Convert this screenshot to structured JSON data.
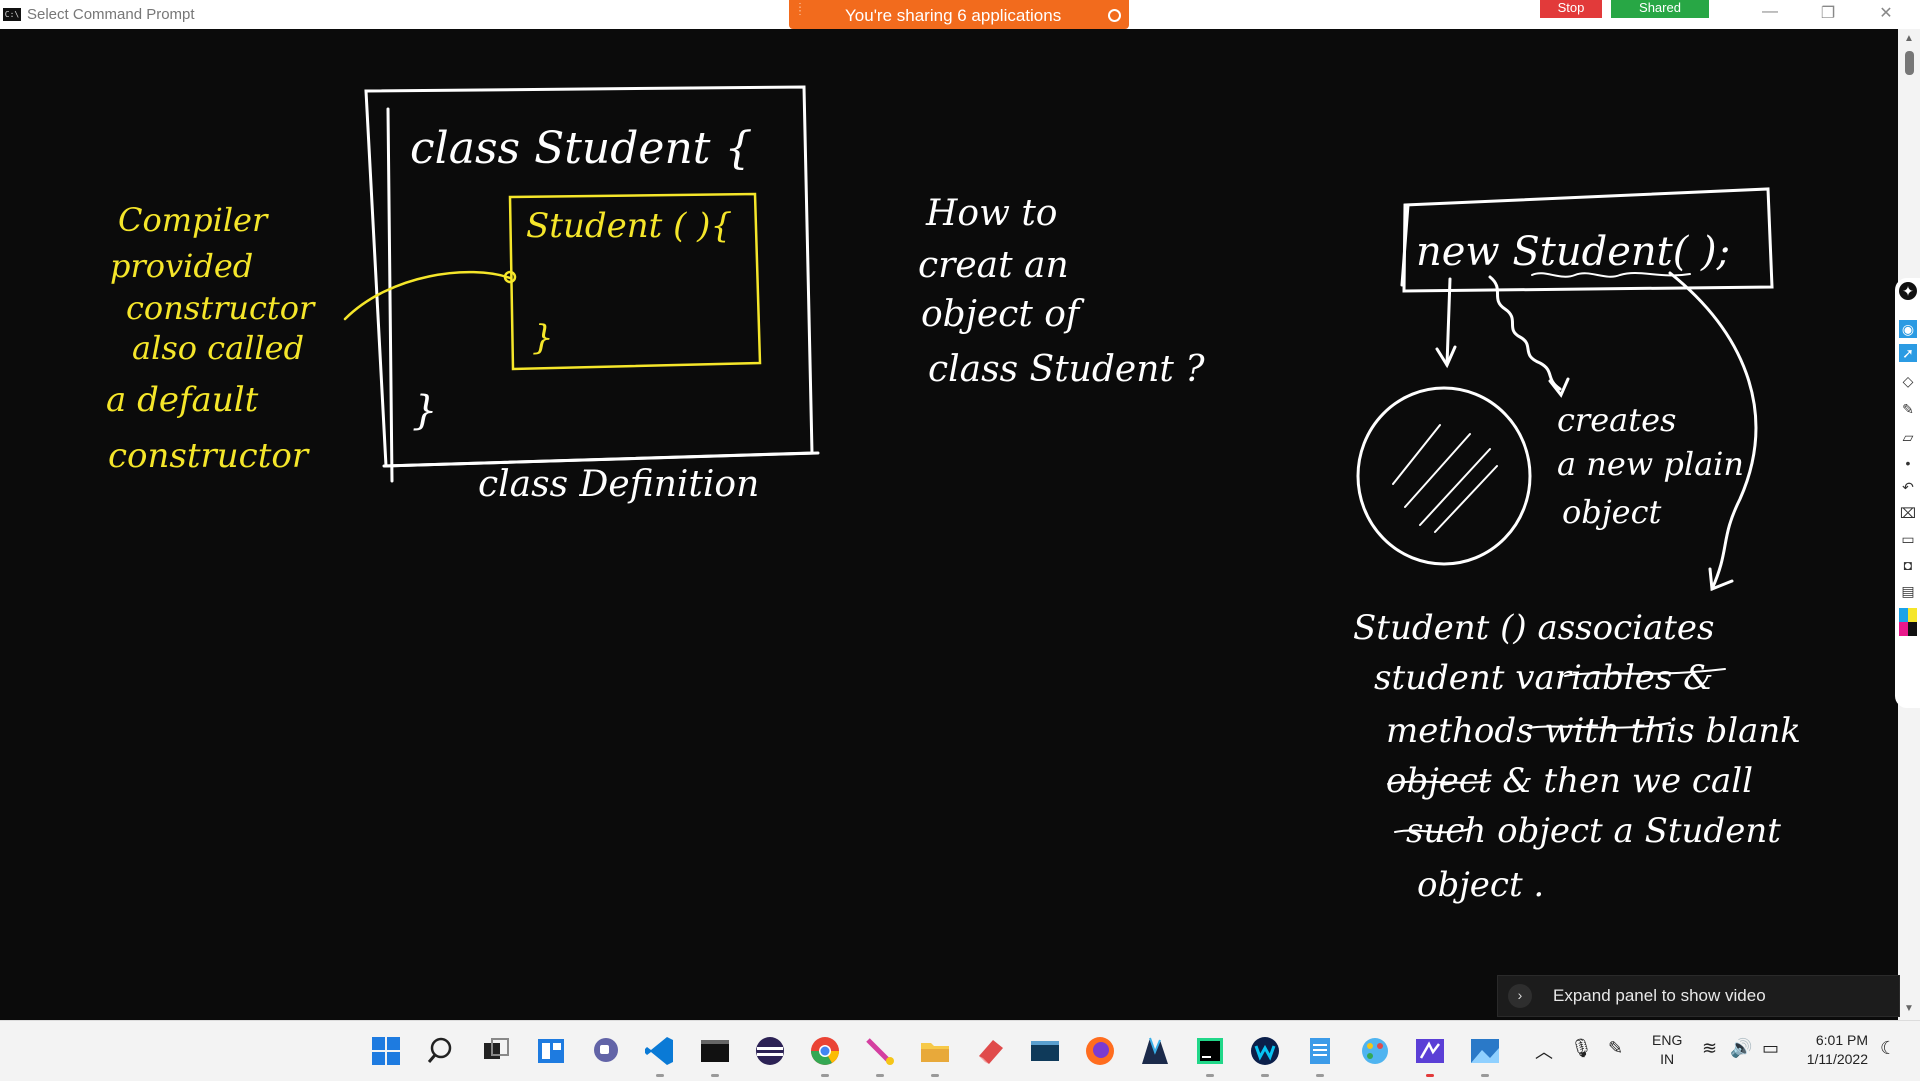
{
  "window": {
    "title": "Select Command Prompt",
    "app_icon": "cmd-icon"
  },
  "sharing_bar": {
    "message": "You're sharing 6 applications"
  },
  "meeting": {
    "stop_label": "Stop",
    "shared_label": "Shared"
  },
  "window_controls": {
    "minimize": "—",
    "restore": "❐",
    "close": "✕"
  },
  "whiteboard": {
    "class_box": {
      "header": "class  Student {",
      "inner_constructor": "Student ( ){",
      "inner_close": "}",
      "outer_close": "}",
      "caption": "class  Definition"
    },
    "compiler_note": [
      "Compiler",
      "provided",
      "constructor",
      "also called",
      "a default",
      "constructor"
    ],
    "question": [
      "How to",
      "creat an",
      "object of",
      "class Student ?"
    ],
    "new_box": "new Student( );",
    "creates_note": [
      "creates",
      "a new plain",
      "object"
    ],
    "explanation": [
      "Student () associates",
      "student variables &",
      "methods with this blank",
      "object & then we call",
      "such object a Student",
      "object ."
    ],
    "colors": {
      "ink_white": "#ffffff",
      "ink_yellow": "#f5e62a",
      "background": "#0b0b0b"
    }
  },
  "video_panel": {
    "label": "Expand panel to show video"
  },
  "taskbar": {
    "apps": [
      "windows-start-icon",
      "search-icon",
      "task-view-icon",
      "widgets-icon",
      "chat-icon",
      "vscode-icon",
      "terminal-icon",
      "eclipse-icon",
      "chrome-icon",
      "pen-tool-icon",
      "file-explorer-icon",
      "eraser-app-icon",
      "mysql-icon",
      "firefox-icon",
      "ide-icon",
      "pycharm-icon",
      "webex-icon",
      "notepad-icon",
      "paint-icon",
      "whiteboard-app-icon",
      "photos-icon"
    ],
    "lang_primary": "ENG",
    "lang_secondary": "IN",
    "time": "6:01 PM",
    "date": "1/11/2022"
  }
}
